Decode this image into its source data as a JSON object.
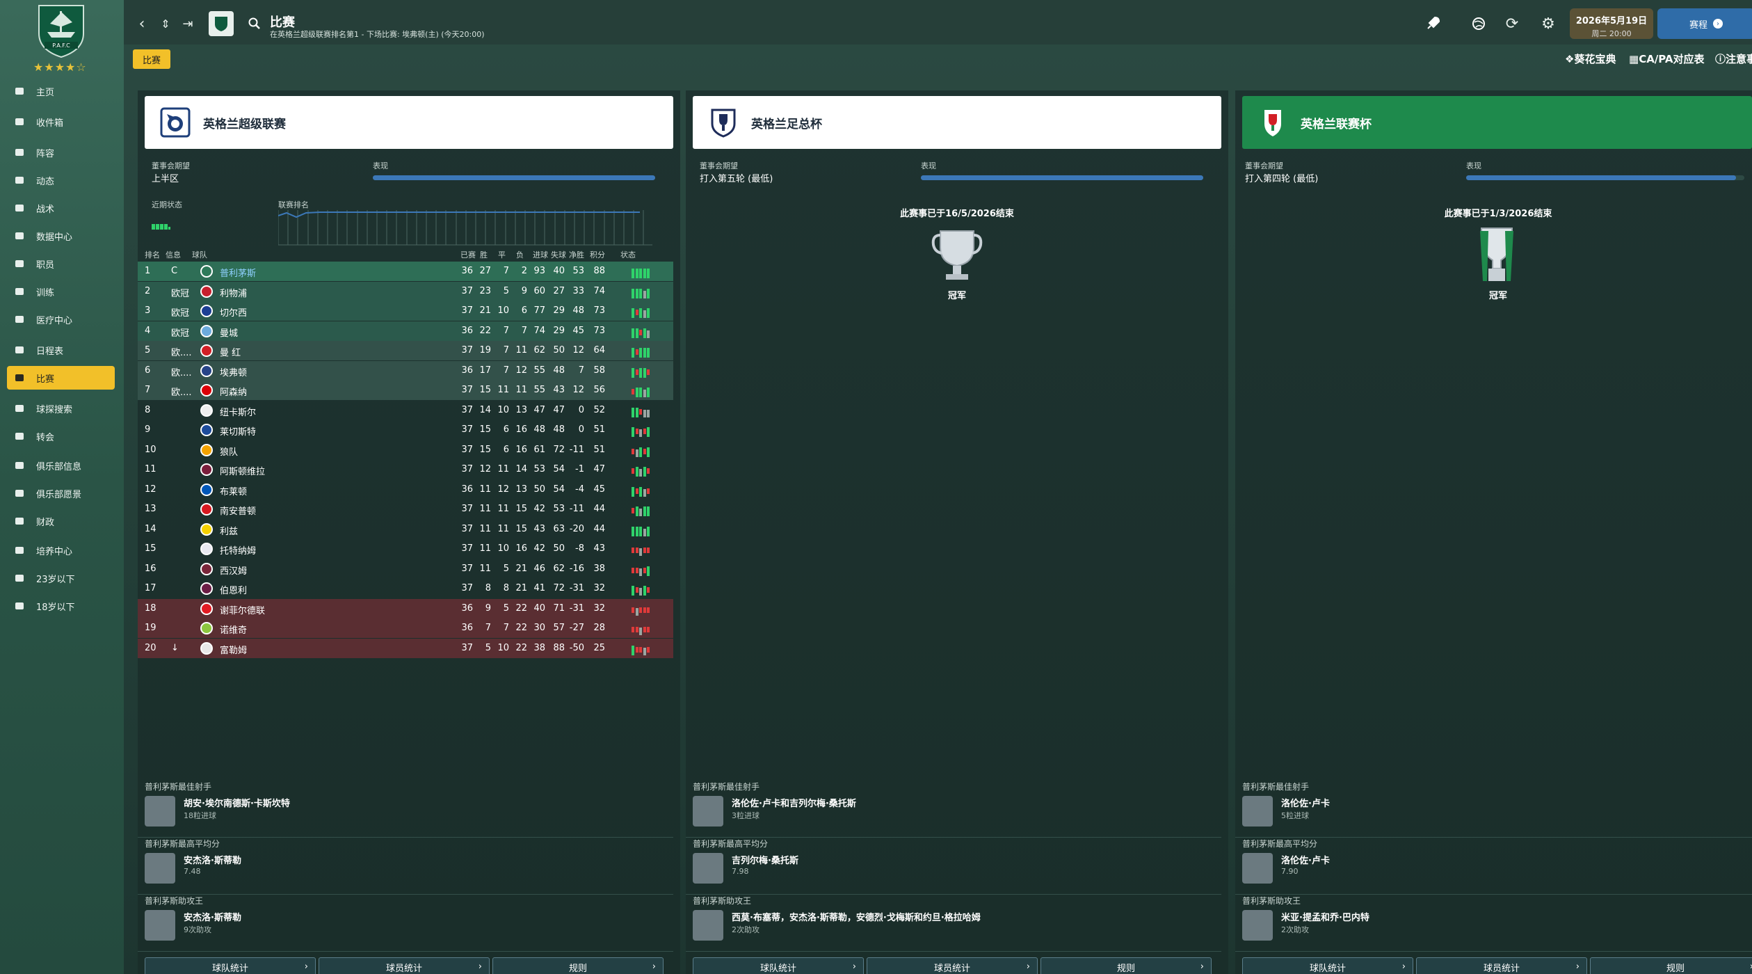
{
  "sidebar": {
    "club_crest_label": "P.A.F.C",
    "stars": "★★★★☆",
    "items": [
      {
        "label": "主页",
        "icon": "home-icon"
      },
      {
        "label": "收件箱",
        "icon": "inbox-icon"
      },
      {
        "label": "阵容",
        "icon": "squad-icon"
      },
      {
        "label": "动态",
        "icon": "dynamics-icon"
      },
      {
        "label": "战术",
        "icon": "tactics-icon"
      },
      {
        "label": "数据中心",
        "icon": "data-hub-icon"
      },
      {
        "label": "职员",
        "icon": "staff-icon"
      },
      {
        "label": "训练",
        "icon": "training-icon"
      },
      {
        "label": "医疗中心",
        "icon": "medical-icon"
      },
      {
        "label": "日程表",
        "icon": "calendar-icon"
      },
      {
        "label": "比赛",
        "icon": "trophy-icon"
      },
      {
        "label": "球探搜索",
        "icon": "scouting-icon"
      },
      {
        "label": "转会",
        "icon": "transfer-icon"
      },
      {
        "label": "俱乐部信息",
        "icon": "club-info-icon"
      },
      {
        "label": "俱乐部愿景",
        "icon": "vision-icon"
      },
      {
        "label": "财政",
        "icon": "finance-icon"
      },
      {
        "label": "培养中心",
        "icon": "development-icon"
      },
      {
        "label": "23岁以下",
        "icon": "u23-icon"
      },
      {
        "label": "18岁以下",
        "icon": "u18-icon"
      }
    ],
    "active_index": 10
  },
  "topbar": {
    "title": "比赛",
    "subtitle": "在英格兰超级联赛排名第1 - 下场比赛: 埃弗顿(主) (今天20:00)",
    "date": "2026年5月19日",
    "day_time": "周二 20:00",
    "continue_label": "赛程",
    "tag": "比赛",
    "links": [
      "葵花宝典",
      "CA/PA对应表",
      "注意事"
    ]
  },
  "competitions": [
    {
      "name": "英格兰超级联赛",
      "board_expect_label": "董事会期望",
      "board_expect_value": "上半区",
      "perf_label": "表现",
      "perf_fraction": 1.0,
      "recent_form_label": "近期状态",
      "league_pos_label": "联赛排名",
      "table_headers": [
        "排名",
        "信息",
        "球队",
        "已赛",
        "胜",
        "平",
        "负",
        "进球",
        "失球",
        "净胜",
        "积分",
        "状态"
      ],
      "table": [
        {
          "pos": "1",
          "info": "C",
          "team": "普利茅斯",
          "p": 36,
          "w": 27,
          "d": 7,
          "l": 2,
          "gf": 93,
          "ga": 40,
          "gd": 53,
          "pts": 88,
          "crest": "#2e7a5a",
          "form": "WWWWW"
        },
        {
          "pos": "2",
          "info": "欧冠",
          "team": "利物浦",
          "p": 37,
          "w": 23,
          "d": 5,
          "l": 9,
          "gf": 60,
          "ga": 27,
          "gd": 33,
          "pts": 74,
          "crest": "#c8202e",
          "form": "WWWDW"
        },
        {
          "pos": "3",
          "info": "欧冠",
          "team": "切尔西",
          "p": 37,
          "w": 21,
          "d": 10,
          "l": 6,
          "gf": 77,
          "ga": 29,
          "gd": 48,
          "pts": 73,
          "crest": "#1c3f94",
          "form": "WLWDW"
        },
        {
          "pos": "4",
          "info": "欧冠",
          "team": "曼城",
          "p": 36,
          "w": 22,
          "d": 7,
          "l": 7,
          "gf": 74,
          "ga": 29,
          "gd": 45,
          "pts": 73,
          "crest": "#6cabdd",
          "form": "WWLWD"
        },
        {
          "pos": "5",
          "info": "欧....",
          "team": "曼 红",
          "p": 37,
          "w": 19,
          "d": 7,
          "l": 11,
          "gf": 62,
          "ga": 50,
          "gd": 12,
          "pts": 64,
          "crest": "#d21f26",
          "form": "WLWWW"
        },
        {
          "pos": "6",
          "info": "欧....",
          "team": "埃弗顿",
          "p": 36,
          "w": 17,
          "d": 7,
          "l": 12,
          "gf": 55,
          "ga": 48,
          "gd": 7,
          "pts": 58,
          "crest": "#274488",
          "form": "WLWWL"
        },
        {
          "pos": "7",
          "info": "欧....",
          "team": "阿森纳",
          "p": 37,
          "w": 15,
          "d": 11,
          "l": 11,
          "gf": 55,
          "ga": 43,
          "gd": 12,
          "pts": 56,
          "crest": "#db0007",
          "form": "LWWDW"
        },
        {
          "pos": "8",
          "info": "",
          "team": "纽卡斯尔",
          "p": 37,
          "w": 14,
          "d": 10,
          "l": 13,
          "gf": 47,
          "ga": 47,
          "gd": 0,
          "pts": 52,
          "crest": "#eeeeee",
          "form": "WWLDD"
        },
        {
          "pos": "9",
          "info": "",
          "team": "莱切斯特",
          "p": 37,
          "w": 15,
          "d": 6,
          "l": 16,
          "gf": 48,
          "ga": 48,
          "gd": 0,
          "pts": 51,
          "crest": "#1d4c9c",
          "form": "WLDLW"
        },
        {
          "pos": "10",
          "info": "",
          "team": "狼队",
          "p": 37,
          "w": 15,
          "d": 6,
          "l": 16,
          "gf": 61,
          "ga": 72,
          "gd": -11,
          "pts": 51,
          "crest": "#f4a300",
          "form": "LDWLW"
        },
        {
          "pos": "11",
          "info": "",
          "team": "阿斯顿维拉",
          "p": 37,
          "w": 12,
          "d": 11,
          "l": 14,
          "gf": 53,
          "ga": 54,
          "gd": -1,
          "pts": 47,
          "crest": "#7b1e3c",
          "form": "LWDWL"
        },
        {
          "pos": "12",
          "info": "",
          "team": "布莱顿",
          "p": 36,
          "w": 11,
          "d": 12,
          "l": 13,
          "gf": 50,
          "ga": 54,
          "gd": -4,
          "pts": 45,
          "crest": "#0057b8",
          "form": "WLWDL"
        },
        {
          "pos": "13",
          "info": "",
          "team": "南安普顿",
          "p": 37,
          "w": 11,
          "d": 11,
          "l": 15,
          "gf": 42,
          "ga": 53,
          "gd": -11,
          "pts": 44,
          "crest": "#d71920",
          "form": "LWDWW"
        },
        {
          "pos": "14",
          "info": "",
          "team": "利兹",
          "p": 37,
          "w": 11,
          "d": 11,
          "l": 15,
          "gf": 43,
          "ga": 63,
          "gd": -20,
          "pts": 44,
          "crest": "#f5d000",
          "form": "WWWDW"
        },
        {
          "pos": "15",
          "info": "",
          "team": "托特纳姆",
          "p": 37,
          "w": 11,
          "d": 10,
          "l": 16,
          "gf": 42,
          "ga": 50,
          "gd": -8,
          "pts": 43,
          "crest": "#e8e8f0",
          "form": "LLDLL"
        },
        {
          "pos": "16",
          "info": "",
          "team": "西汉姆",
          "p": 37,
          "w": 11,
          "d": 5,
          "l": 21,
          "gf": 46,
          "ga": 62,
          "gd": -16,
          "pts": 38,
          "crest": "#7a263a",
          "form": "LLDLW"
        },
        {
          "pos": "17",
          "info": "",
          "team": "伯恩利",
          "p": 37,
          "w": 8,
          "d": 8,
          "l": 21,
          "gf": 41,
          "ga": 72,
          "gd": -31,
          "pts": 32,
          "crest": "#6c1d45",
          "form": "WLDWL"
        },
        {
          "pos": "18",
          "info": "",
          "team": "谢菲尔德联",
          "p": 36,
          "w": 9,
          "d": 5,
          "l": 22,
          "gf": 40,
          "ga": 71,
          "gd": -31,
          "pts": 32,
          "crest": "#e21b23",
          "form": "LDLLL"
        },
        {
          "pos": "19",
          "info": "",
          "team": "诺维奇",
          "p": 36,
          "w": 7,
          "d": 7,
          "l": 22,
          "gf": 30,
          "ga": 57,
          "gd": -27,
          "pts": 28,
          "crest": "#8cc63f",
          "form": "LLDLL"
        },
        {
          "pos": "20",
          "info": "↓",
          "team": "富勒姆",
          "p": 37,
          "w": 5,
          "d": 10,
          "l": 22,
          "gf": 38,
          "ga": 88,
          "gd": -50,
          "pts": 25,
          "crest": "#e8e8e8",
          "form": "WLLDL"
        }
      ],
      "stats": [
        {
          "title": "普利茅斯最佳射手",
          "name": "胡安·埃尔南德斯·卡斯坎特",
          "value": "18粒进球"
        },
        {
          "title": "普利茅斯最高平均分",
          "name": "安杰洛·斯蒂勒",
          "value": "7.48"
        },
        {
          "title": "普利茅斯助攻王",
          "name": "安杰洛·斯蒂勒",
          "value": "9次助攻"
        }
      ],
      "buttons": [
        "球队统计",
        "球员统计",
        "规则"
      ]
    },
    {
      "name": "英格兰足总杯",
      "board_expect_label": "董事会期望",
      "board_expect_value": "打入第五轮 (最低)",
      "perf_label": "表现",
      "perf_fraction": 1.0,
      "ended_text": "此赛事已于16/5/2026结束",
      "result": "冠军",
      "stats": [
        {
          "title": "普利茅斯最佳射手",
          "name": "洛伦佐·卢卡和吉列尔梅·桑托斯",
          "value": "3粒进球"
        },
        {
          "title": "普利茅斯最高平均分",
          "name": "吉列尔梅·桑托斯",
          "value": "7.98"
        },
        {
          "title": "普利茅斯助攻王",
          "name": "西莫·布塞蒂，安杰洛·斯蒂勒，安德烈·戈梅斯和约旦·格拉哈姆",
          "value": "2次助攻"
        }
      ],
      "buttons": [
        "球队统计",
        "球员统计",
        "规则"
      ]
    },
    {
      "name": "英格兰联赛杯",
      "board_expect_label": "董事会期望",
      "board_expect_value": "打入第四轮 (最低)",
      "perf_label": "表现",
      "perf_fraction": 0.97,
      "ended_text": "此赛事已于1/3/2026结束",
      "result": "冠军",
      "stats": [
        {
          "title": "普利茅斯最佳射手",
          "name": "洛伦佐·卢卡",
          "value": "5粒进球"
        },
        {
          "title": "普利茅斯最高平均分",
          "name": "洛伦佐·卢卡",
          "value": "7.90"
        },
        {
          "title": "普利茅斯助攻王",
          "name": "米亚·提孟和乔·巴内特",
          "value": "2次助攻"
        }
      ],
      "buttons": [
        "球队统计",
        "球员统计",
        "规则"
      ]
    }
  ],
  "colors": {
    "accent": "#f2c029",
    "win": "#2fd36a",
    "loss": "#e03a3a",
    "draw": "#9aa7a2",
    "blue": "#3c78b8"
  }
}
